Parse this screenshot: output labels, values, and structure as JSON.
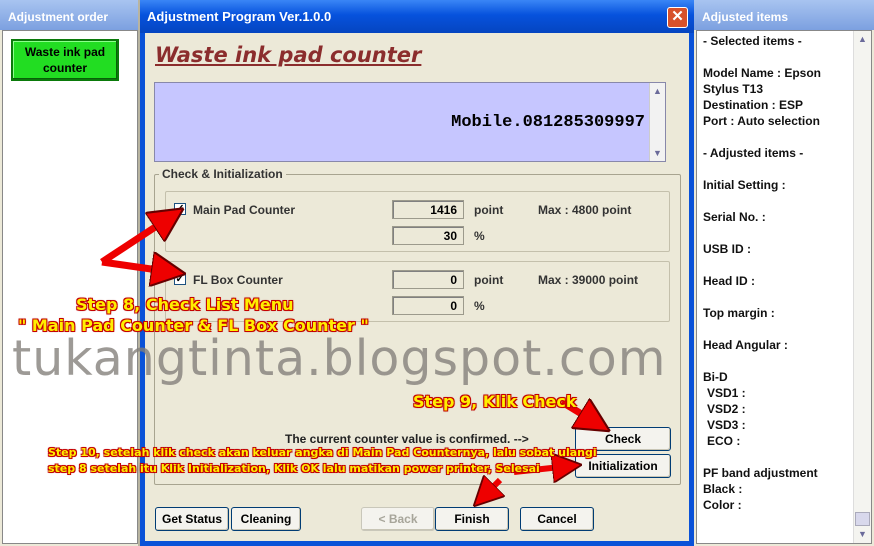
{
  "left_panel": {
    "title": "Adjustment order",
    "active_item": "Waste ink pad counter"
  },
  "window": {
    "title": "Adjustment Program Ver.1.0.0",
    "close_symbol": "✕",
    "heading": "Waste ink pad counter",
    "banner_text": "Mobile.081285309997",
    "group_label": "Check & Initialization",
    "main_pad": {
      "label": "Main Pad Counter",
      "checked": "✓",
      "point_value": "1416",
      "point_unit": "point",
      "max": "Max : 4800 point",
      "percent_value": "30",
      "percent_unit": "%"
    },
    "fl_box": {
      "label": "FL Box Counter",
      "checked": "✓",
      "point_value": "0",
      "point_unit": "point",
      "max": "Max : 39000 point",
      "percent_value": "0",
      "percent_unit": "%"
    },
    "confirm_text": "The current counter value is confirmed. -->",
    "buttons": {
      "check": "Check",
      "initialization": "Initialization",
      "get_status": "Get Status",
      "cleaning": "Cleaning",
      "back": "< Back",
      "finish": "Finish",
      "cancel": "Cancel"
    }
  },
  "right_panel": {
    "title": "Adjusted items",
    "lines": [
      "- Selected items -",
      "Model Name : Epson",
      "Stylus T13",
      "Destination : ESP",
      "Port : Auto selection",
      "- Adjusted items -",
      "Initial Setting :",
      "Serial No. :",
      "USB ID :",
      "Head ID :",
      "Top margin :",
      "Head Angular :",
      "Bi-D",
      " VSD1 :",
      " VSD2 :",
      " VSD3 :",
      " ECO  :",
      "PF band adjustment",
      "Black :",
      "Color :"
    ]
  },
  "annotations": {
    "step8_line1": "Step 8,  Check List Menu",
    "step8_line2": "\" Main Pad Counter  & FL Box Counter \"",
    "watermark": "tukangtinta.blogspot.com",
    "step9": "Step 9, Klik Check",
    "step10_line1": "Step 10, setelah klik check akan keluar angka di Main Pad Counternya, lalu sobat ulangi",
    "step10_line2": "step 8 setelah itu Klik Initialization, Klik OK lalu matikan power printer, Selesai"
  },
  "colors": {
    "title_blue": "#0652dd",
    "active_green": "#22dd22",
    "heading_red": "#8b2d2d",
    "annotation_yellow": "#ffee00",
    "annotation_red": "#c40000"
  }
}
